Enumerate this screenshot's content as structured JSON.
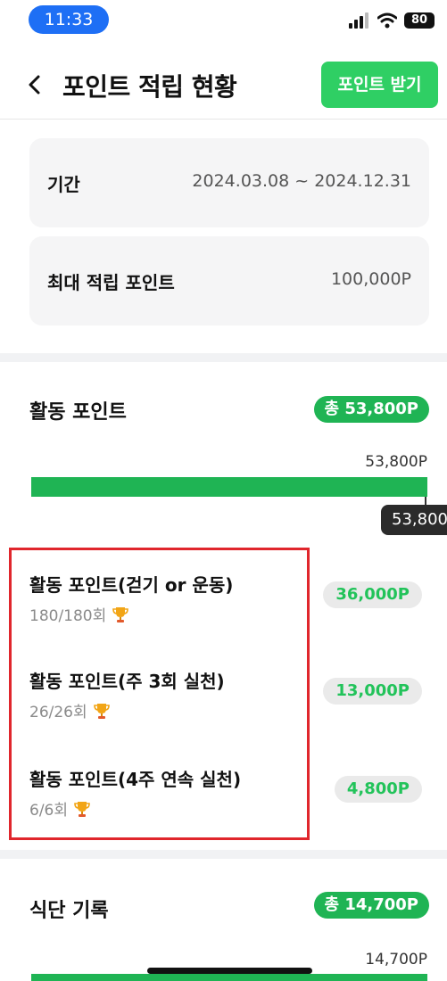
{
  "status_bar": {
    "time": "11:33",
    "battery": "80"
  },
  "header": {
    "title": "포인트 적립 현황",
    "receive_button": "포인트 받기"
  },
  "info": {
    "period_label": "기간",
    "period_value": "2024.03.08 ~ 2024.12.31",
    "max_label": "최대 적립 포인트",
    "max_value": "100,000P"
  },
  "activity": {
    "title": "활동 포인트",
    "total_badge": "총 53,800P",
    "bar_label": "53,800P",
    "bar_fill_percent": 100,
    "tooltip": "53,800",
    "items": [
      {
        "name": "활동 포인트(걷기 or 운동)",
        "count": "180/180회",
        "points": "36,000P"
      },
      {
        "name": "활동 포인트(주 3회 실천)",
        "count": "26/26회",
        "points": "13,000P"
      },
      {
        "name": "활동 포인트(4주 연속 실천)",
        "count": "6/6회",
        "points": "4,800P"
      }
    ]
  },
  "diet": {
    "title": "식단 기록",
    "total_badge": "총 14,700P",
    "bar_label": "14,700P",
    "bar_fill_percent": 100
  },
  "colors": {
    "accent_green": "#1fb454",
    "button_green": "#2fcf64",
    "highlight_red": "#e0262c",
    "time_pill_blue": "#1e6ff5"
  },
  "icons": [
    "back-icon",
    "wifi-icon",
    "signal-icon",
    "trophy-icon"
  ]
}
